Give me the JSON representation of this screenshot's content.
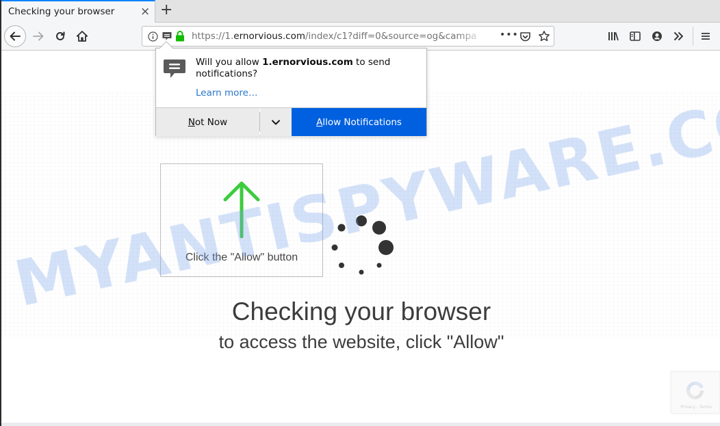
{
  "browser": {
    "tab": {
      "title": "Checking your browser",
      "close_icon": "×"
    },
    "new_tab_icon": "+",
    "urlbar": {
      "prefix": "https://1.",
      "domain": "ernorvious.com",
      "path": "/index/c1?diff=0&source=og&campa",
      "more_icon": "•••"
    },
    "colors": {
      "accent": "#0a84ff",
      "lock": "#12bc00",
      "allow_button": "#0060df",
      "learn_more": "#2a77c9"
    }
  },
  "doorhanger": {
    "message_prefix": "Will you allow ",
    "message_domain": "1.ernorvious.com",
    "message_suffix": " to send notifications?",
    "learn_more": "Learn more…",
    "not_now": "Not Now",
    "allow": "Allow Notifications"
  },
  "page": {
    "watermark": "MYANTISPYWARE.COM",
    "allow_caption": "Click the \"Allow\" button",
    "headline": "Checking your browser",
    "subline": "to access the website, click \"Allow\"",
    "recaptcha_links": "Privacy - Terms",
    "arrow_color": "#3dcc3d"
  }
}
